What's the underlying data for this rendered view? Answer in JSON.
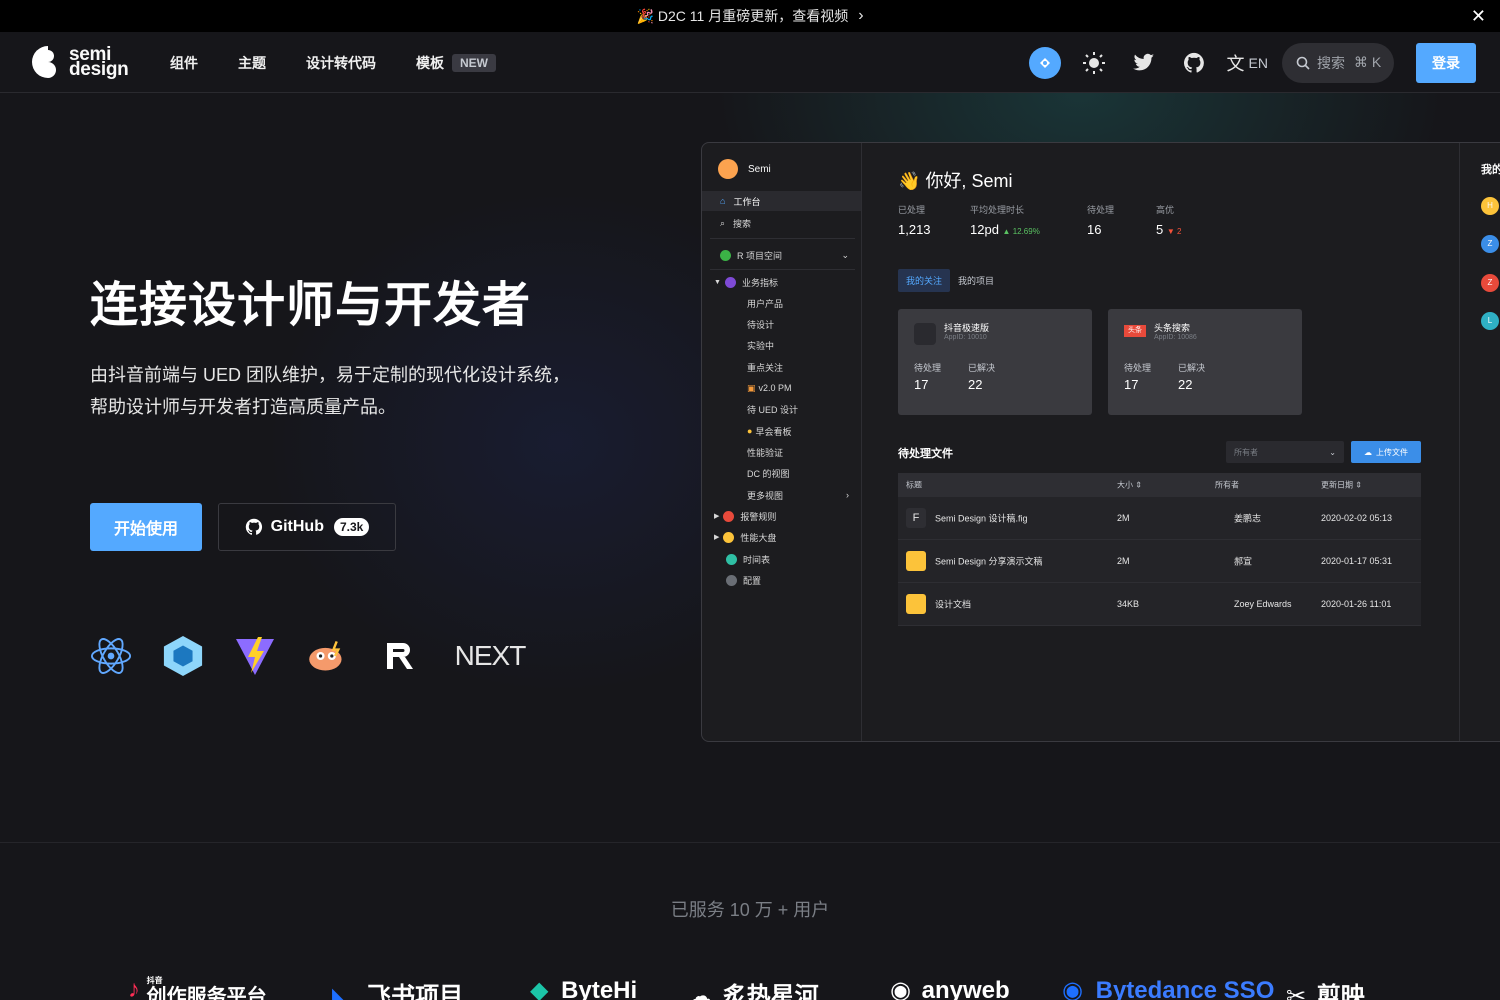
{
  "announcement": {
    "icon": "🎉",
    "text": "D2C 11 月重磅更新，查看视频",
    "arrow": "›",
    "close": "✕"
  },
  "nav": {
    "logo_line1": "semi",
    "logo_line2": "design",
    "links": [
      "组件",
      "主题",
      "设计转代码",
      "模板"
    ],
    "new_tag": "NEW",
    "lang": "EN",
    "search_placeholder": "搜索",
    "search_shortcut": "⌘ K",
    "login": "登录"
  },
  "hero": {
    "title": "连接设计师与开发者",
    "desc_line1": "由抖音前端与 UED 团队维护，易于定制的现代化设计系统，",
    "desc_line2": "帮助设计师与开发者打造高质量产品。",
    "start_button": "开始使用",
    "github_button": "GitHub",
    "github_stars": "7.3k",
    "tech_icons": [
      "react-icon",
      "webpack-icon",
      "vite-icon",
      "rspack-icon",
      "remix-icon",
      "nextjs-icon"
    ],
    "next_label": "NEXT"
  },
  "demo": {
    "user": "Semi",
    "sidebar": {
      "workbench": "工作台",
      "search": "搜索",
      "project_space": "R 项目空间",
      "metrics": "业务指标",
      "items": [
        "用户产品",
        "待设计",
        "实验中",
        "重点关注",
        "v2.0 PM",
        "待 UED 设计",
        "早会看板",
        "性能验证",
        "DC 的视图",
        "更多视图"
      ],
      "groups": [
        "报警规则",
        "性能大盘",
        "时间表",
        "配置"
      ]
    },
    "greeting": "你好, Semi",
    "greeting_icon": "👋",
    "stats": [
      {
        "label": "已处理",
        "value": "1,213",
        "delta": ""
      },
      {
        "label": "平均处理时长",
        "value": "12pd",
        "delta": "▲ 12.69%"
      },
      {
        "label": "待处理",
        "value": "16",
        "delta": ""
      },
      {
        "label": "高优",
        "value": "5",
        "delta": "▼ 2"
      }
    ],
    "tabs": [
      "我的关注",
      "我的项目"
    ],
    "cards": [
      {
        "name": "抖音极速版",
        "app_id": "AppID: 10010",
        "pending_label": "待处理",
        "pending": "17",
        "resolved_label": "已解决",
        "resolved": "22"
      },
      {
        "name": "头条搜索",
        "app_id": "AppID: 10086",
        "pending_label": "待处理",
        "pending": "17",
        "resolved_label": "已解决",
        "resolved": "22"
      }
    ],
    "toutiao_badge": "头条",
    "files_title": "待处理文件",
    "owner_select": "所有者",
    "upload": "上传文件",
    "table_headers": [
      "标题",
      "大小 ⇕",
      "所有者",
      "更新日期 ⇕"
    ],
    "rows": [
      {
        "title": "Semi Design 设计稿.fig",
        "size": "2M",
        "owner": "姜鹏志",
        "date": "2020-02-02 05:13"
      },
      {
        "title": "Semi Design 分享演示文稿",
        "size": "2M",
        "owner": "郝宣",
        "date": "2020-01-17 05:31"
      },
      {
        "title": "设计文档",
        "size": "34KB",
        "owner": "Zoey Edwards",
        "date": "2020-01-26 11:01"
      }
    ],
    "right_title": "我的",
    "right_avatars": [
      "H",
      "Z",
      "Z",
      "L"
    ]
  },
  "served": "已服务 10 万 + 用户",
  "brands": [
    "抖音",
    "创作服务平台",
    "飞书项目",
    "ByteHi",
    "炙热星河",
    "anyweb",
    "Bytedance SSO",
    "剪映"
  ],
  "colors": {
    "accent": "#54a9ff",
    "bg": "#16161a"
  }
}
